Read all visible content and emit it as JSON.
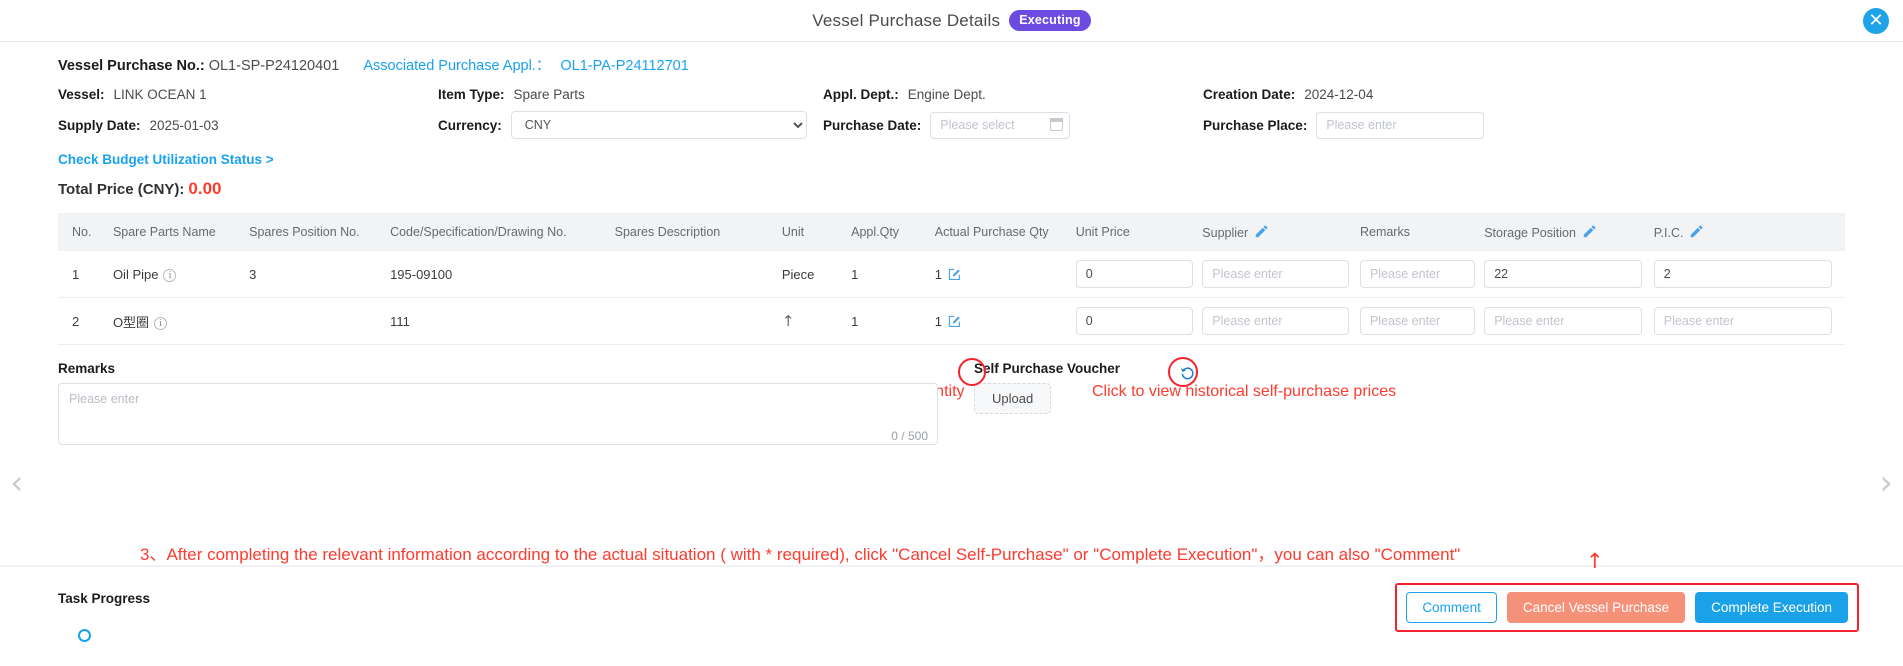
{
  "header": {
    "title": "Vessel Purchase Details",
    "status": "Executing",
    "close_icon": "close-icon"
  },
  "info": {
    "purchase_no_label": "Vessel Purchase No.:",
    "purchase_no_value": "OL1-SP-P24120401",
    "associated_label": "Associated Purchase Appl.：",
    "associated_value": "OL1-PA-P24112701",
    "vessel_label": "Vessel:",
    "vessel_value": "LINK OCEAN 1",
    "item_type_label": "Item Type:",
    "item_type_value": "Spare Parts",
    "appl_dept_label": "Appl. Dept.:",
    "appl_dept_value": "Engine Dept.",
    "creation_date_label": "Creation Date:",
    "creation_date_value": "2024-12-04",
    "supply_date_label": "Supply Date:",
    "supply_date_value": "2025-01-03",
    "currency_label": "Currency:",
    "currency_value": "CNY",
    "purchase_date_label": "Purchase Date:",
    "purchase_date_placeholder": "Please select",
    "purchase_place_label": "Purchase Place:",
    "purchase_place_placeholder": "Please enter",
    "budget_link": "Check Budget Utilization Status >",
    "total_label": "Total Price (CNY):",
    "total_value": "0.00",
    "accent_link_color": "#1aa1f0",
    "total_color": "#ff3b30"
  },
  "table": {
    "columns": [
      "No.",
      "Spare Parts Name",
      "Spares Position No.",
      "Code/Specification/Drawing No.",
      "Spares Description",
      "Unit",
      "Appl.Qty",
      "Actual Purchase Qty",
      "Unit Price",
      "Supplier",
      "Remarks",
      "Storage Position",
      "P.I.C."
    ],
    "editable_headers": [
      "Supplier",
      "Storage Position",
      "P.I.C."
    ],
    "rows": [
      {
        "no": "1",
        "name": "Oil Pipe",
        "position_no": "3",
        "code": "195-09100",
        "description": "",
        "unit": "Piece",
        "appl_qty": "1",
        "actual_qty": "1",
        "unit_price": "0",
        "supplier": "",
        "supplier_placeholder": "Please enter",
        "remarks": "",
        "remarks_placeholder": "Please enter",
        "storage_position": "22",
        "storage_placeholder": "Please enter",
        "pic": "2",
        "pic_placeholder": "Please enter"
      },
      {
        "no": "2",
        "name": "O型圈",
        "position_no": "",
        "code": "111",
        "description": "",
        "unit": "↑",
        "appl_qty": "1",
        "actual_qty": "1",
        "unit_price": "0",
        "supplier": "",
        "supplier_placeholder": "Please enter",
        "remarks": "",
        "remarks_placeholder": "Please enter",
        "storage_position": "",
        "storage_placeholder": "Please enter",
        "pic": "",
        "pic_placeholder": "Please enter"
      }
    ]
  },
  "annotations": {
    "modify_qty": "Click to modify quantity",
    "historical_prices": "Click to view historical self-purchase prices",
    "step3": "3、After completing the relevant information according to the actual situation ( with * required), click \"Cancel Self-Purchase\" or \"Complete Execution\"，you can also \"Comment\"",
    "arrow_up": "↑",
    "color": "#fd3b2f"
  },
  "bottom": {
    "remarks_title": "Remarks",
    "remarks_placeholder": "Please enter",
    "remarks_counter": "0 / 500",
    "voucher_title": "Self Purchase Voucher",
    "upload_label": "Upload"
  },
  "footer": {
    "task_progress": "Task Progress",
    "buttons": {
      "comment": "Comment",
      "cancel": "Cancel Vessel Purchase",
      "complete": "Complete Execution"
    },
    "colors": {
      "comment_border": "#1aa1f0",
      "cancel_bg": "#f59179",
      "complete_bg": "#19a2e8"
    }
  },
  "nav": {
    "prev_icon": "chevron-left-icon",
    "next_icon": "chevron-right-icon",
    "prev": "‹",
    "next": "›"
  }
}
